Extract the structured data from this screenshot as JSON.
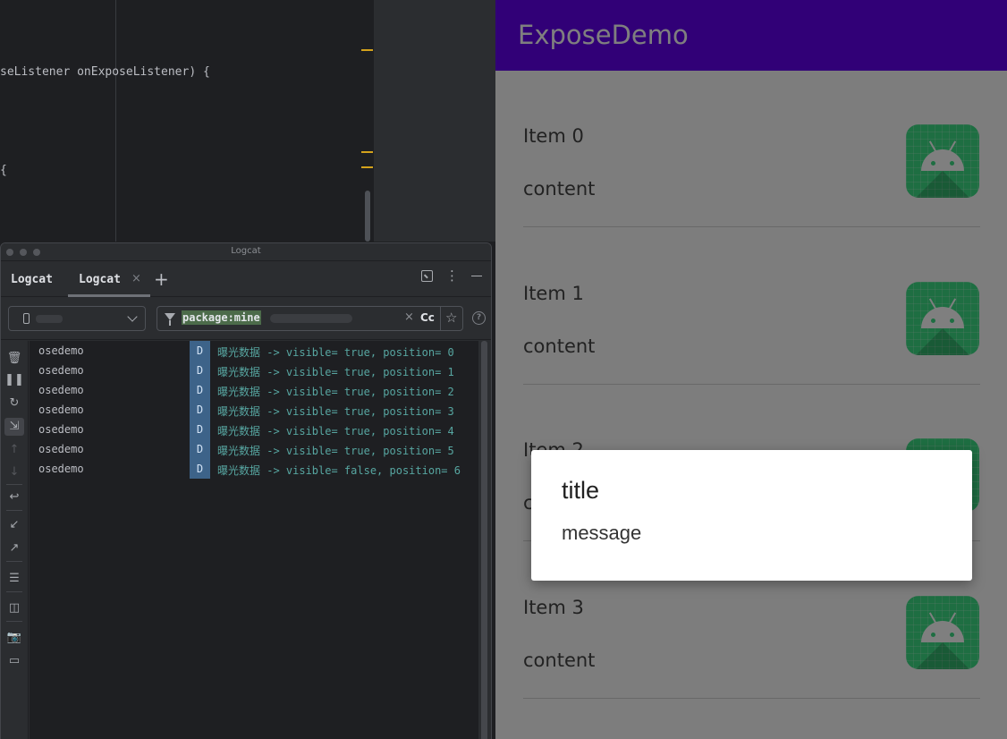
{
  "editor": {
    "code_line_1": "seListener onExposeListener) {",
    "code_line_2": "{"
  },
  "logcat": {
    "window_title": "Logcat",
    "tab_static": "Logcat",
    "tab_active": "Logcat",
    "tab_close": "×",
    "new_tab": "+",
    "filter_query": "package:mine",
    "clear_symbol": "×",
    "match_case": "Cc",
    "favorite": "☆",
    "help": "?",
    "level_label": "D",
    "rows": [
      {
        "pkg": "osedemo",
        "level": "D",
        "message": "曝光数据 -> visible= true, position= 0"
      },
      {
        "pkg": "osedemo",
        "level": "D",
        "message": "曝光数据 -> visible= true, position= 1"
      },
      {
        "pkg": "osedemo",
        "level": "D",
        "message": "曝光数据 -> visible= true, position= 2"
      },
      {
        "pkg": "osedemo",
        "level": "D",
        "message": "曝光数据 -> visible= true, position= 3"
      },
      {
        "pkg": "osedemo",
        "level": "D",
        "message": "曝光数据 -> visible= true, position= 4"
      },
      {
        "pkg": "osedemo",
        "level": "D",
        "message": "曝光数据 -> visible= true, position= 5"
      },
      {
        "pkg": "osedemo",
        "level": "D",
        "message": "曝光数据 -> visible= false, position= 6"
      }
    ]
  },
  "app": {
    "title": "ExposeDemo",
    "accent": "#6200ee",
    "items": [
      {
        "title": "Item 0",
        "content": "content"
      },
      {
        "title": "Item 1",
        "content": "content"
      },
      {
        "title": "Item 2",
        "content": "content"
      },
      {
        "title": "Item 3",
        "content": "content"
      }
    ]
  },
  "dialog": {
    "title": "title",
    "message": "message"
  }
}
